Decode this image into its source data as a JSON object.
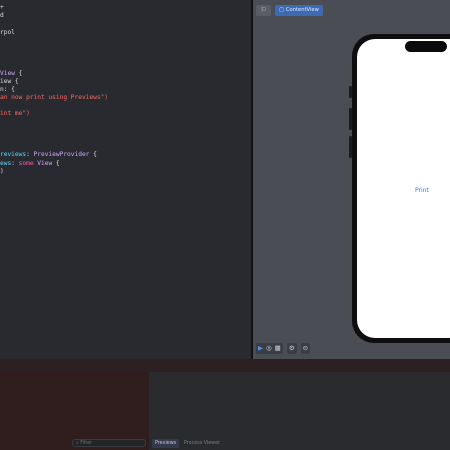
{
  "editor": {
    "lines": [
      {
        "parts": [
          {
            "t": "+",
            "c": "pl"
          }
        ]
      },
      {
        "parts": [
          {
            "t": "d",
            "c": "pl"
          }
        ]
      },
      {
        "parts": []
      },
      {
        "parts": [
          {
            "t": "rpol",
            "c": "pl"
          }
        ]
      },
      {
        "parts": []
      },
      {
        "parts": []
      },
      {
        "parts": []
      },
      {
        "parts": []
      },
      {
        "parts": [
          {
            "t": "View",
            "c": "ty"
          },
          {
            "t": " {",
            "c": "pl"
          }
        ]
      },
      {
        "parts": [
          {
            "t": "iew {",
            "c": "pl"
          }
        ]
      },
      {
        "parts": [
          {
            "t": "n: {",
            "c": "pl"
          }
        ]
      },
      {
        "parts": [
          {
            "t": "an now print using Previews\")",
            "c": "str"
          }
        ]
      },
      {
        "parts": []
      },
      {
        "parts": [
          {
            "t": "int me\")",
            "c": "str"
          }
        ]
      },
      {
        "parts": []
      },
      {
        "parts": []
      },
      {
        "parts": []
      },
      {
        "parts": []
      },
      {
        "parts": [
          {
            "t": "reviews",
            "c": "tm"
          },
          {
            "t": ": ",
            "c": "pl"
          },
          {
            "t": "PreviewProvider",
            "c": "ty"
          },
          {
            "t": " {",
            "c": "pl"
          }
        ]
      },
      {
        "parts": [
          {
            "t": "ews",
            "c": "tm"
          },
          {
            "t": ": ",
            "c": "pl"
          },
          {
            "t": "some",
            "c": "kw"
          },
          {
            "t": " ",
            "c": "pl"
          },
          {
            "t": "View",
            "c": "ty"
          },
          {
            "t": " {",
            "c": "pl"
          }
        ]
      },
      {
        "parts": [
          {
            "t": ")",
            "c": "pl"
          }
        ]
      }
    ]
  },
  "canvas": {
    "pin_icon": "pin-icon",
    "preview_chip_icon": "▢",
    "preview_chip_label": "ContentView",
    "print_button_label": "Print",
    "toolbar": {
      "live": "▶",
      "selectable": "◎",
      "variants": "▦",
      "device": "⚙",
      "zoom": "⊝"
    }
  },
  "debug": {
    "filter_placeholder": "Filter",
    "filter_icon": "⌕",
    "tab_previews": "Previews",
    "tab_console": "Process Viewer"
  },
  "colors": {
    "editor_bg": "#292a30",
    "canvas_bg": "#4a4d53",
    "accent": "#3d6bb3",
    "string": "#fc6a5d",
    "keyword": "#fc5fa3",
    "type": "#d0a8ff"
  }
}
